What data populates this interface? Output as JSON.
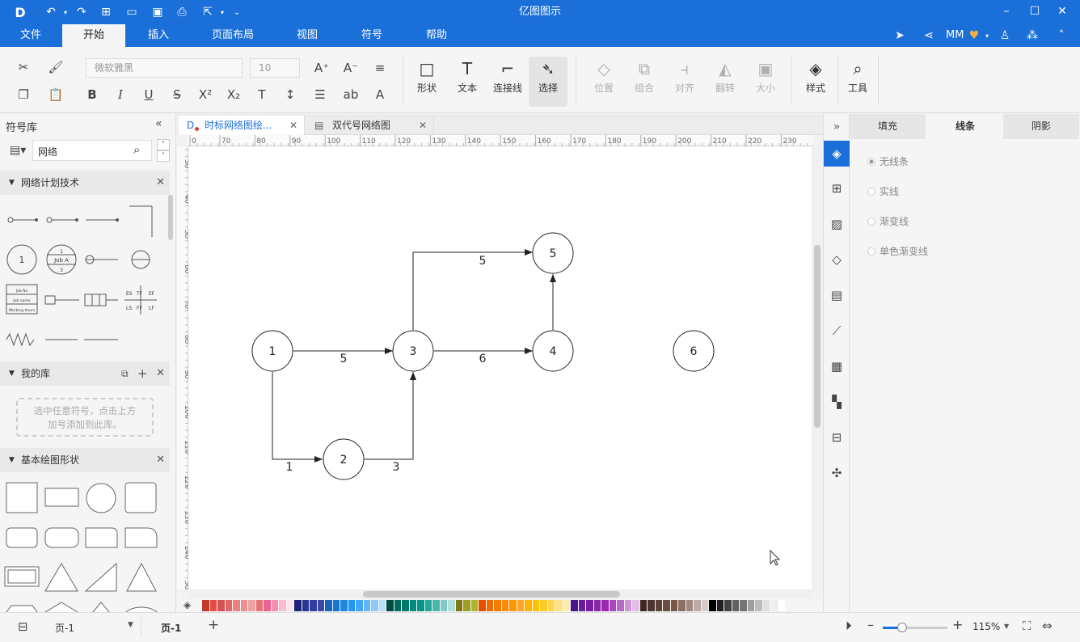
{
  "app": {
    "title": "亿图图示",
    "user": "MM"
  },
  "menu": {
    "items": [
      "文件",
      "开始",
      "插入",
      "页面布局",
      "视图",
      "符号",
      "帮助"
    ],
    "active": "开始"
  },
  "ribbon": {
    "font_name": "微软雅黑",
    "font_size": "10",
    "tools": {
      "shape": "形状",
      "text": "文本",
      "connector": "连接线",
      "select": "选择",
      "position": "位置",
      "group": "组合",
      "align": "对齐",
      "flip": "翻转",
      "size": "大小",
      "style": "样式",
      "tools": "工具"
    }
  },
  "left_panel": {
    "title": "符号库",
    "search_value": "网络",
    "sections": {
      "network": "网络计划技术",
      "my_lib": "我的库",
      "basic": "基本绘图形状"
    },
    "my_lib_hint_1": "选中任意符号，点击上方",
    "my_lib_hint_2": "加号添加到此库。",
    "node_thumb_label": "1",
    "job_a": {
      "top": "1",
      "mid": "Job A",
      "bottom": "3"
    },
    "job_box": {
      "line1": "Job No",
      "line2": "Job name",
      "line3": "Working hours"
    },
    "grid_labels": {
      "es": "ES",
      "tf": "TF",
      "ef": "EF",
      "ls": "LS",
      "ff": "FF",
      "lf": "LF"
    }
  },
  "tabs": [
    {
      "label": "时标网络图绘...",
      "active": true
    },
    {
      "label": "双代号网络图",
      "active": false
    }
  ],
  "ruler": {
    "h_ticks": [
      "0",
      "70",
      "80",
      "90",
      "100",
      "110",
      "120",
      "130",
      "140",
      "150",
      "160",
      "170",
      "180",
      "190",
      "200",
      "210",
      "220",
      "230"
    ],
    "v_ticks": [
      "30",
      "40",
      "50",
      "60",
      "70",
      "80",
      "90",
      "100",
      "110",
      "120",
      "130",
      "140",
      "50"
    ]
  },
  "diagram": {
    "nodes": [
      "1",
      "2",
      "3",
      "4",
      "5",
      "6"
    ],
    "edges": {
      "e13": "5",
      "e12": "1",
      "e23": "3",
      "e34": "6",
      "e35": "5"
    }
  },
  "right_panel": {
    "tabs": [
      "填充",
      "线条",
      "阴影"
    ],
    "active_tab": "线条",
    "options": [
      "无线条",
      "实线",
      "渐变线",
      "单色渐变线"
    ],
    "selected_option": "无线条"
  },
  "status": {
    "page_select": "页-1",
    "page_tab": "页-1",
    "zoom": "115%"
  },
  "colors": {
    "accent": "#1b6fd8"
  }
}
